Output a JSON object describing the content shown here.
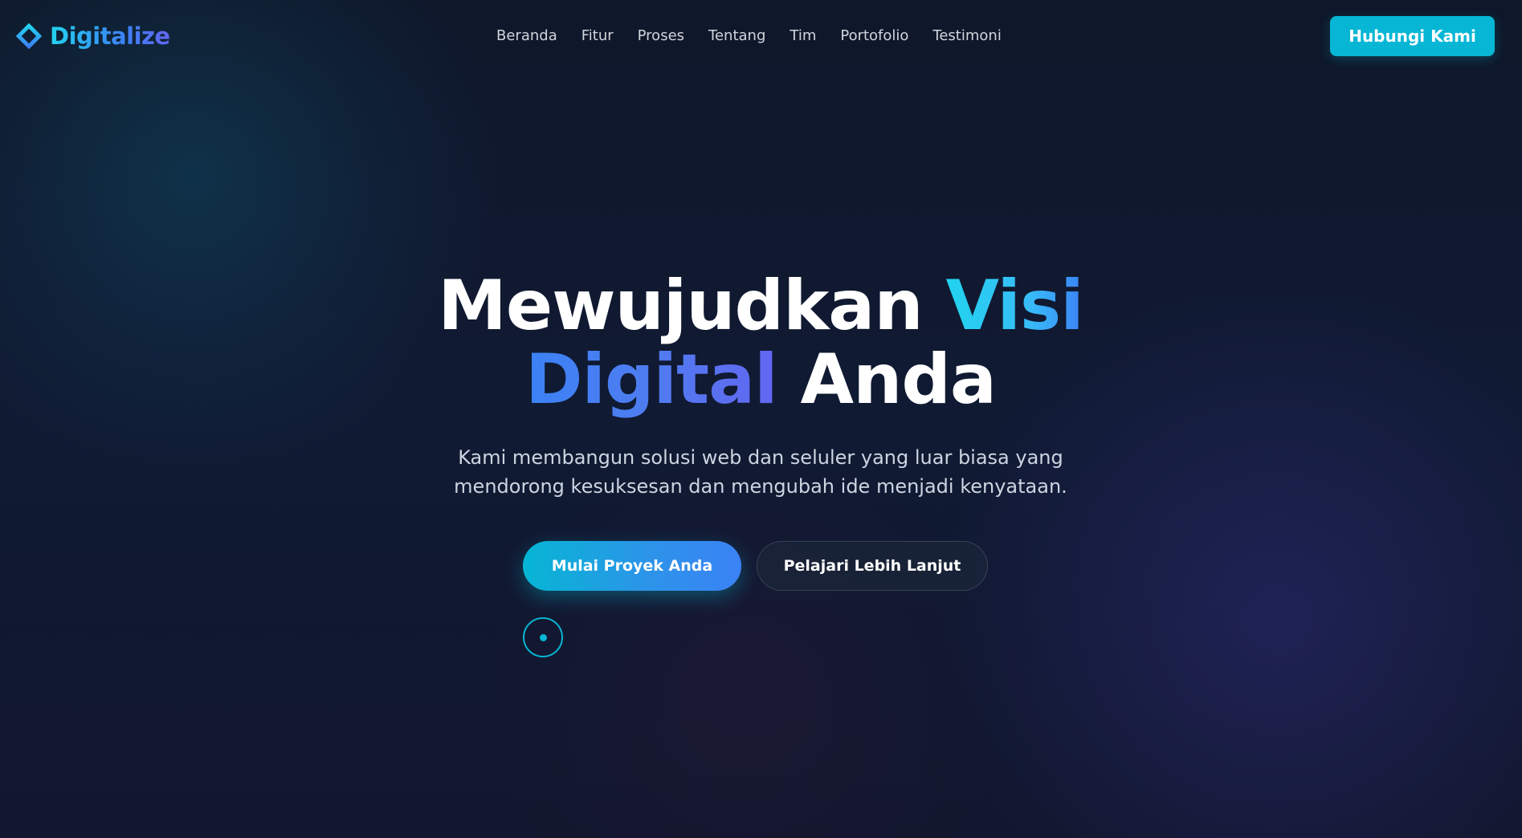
{
  "brand": {
    "name": "Digitalize",
    "icon": "diamond-outline-icon",
    "accent": "#06b6d4",
    "gradient": [
      "#22d3ee",
      "#3b82f6",
      "#6366f1"
    ]
  },
  "nav": {
    "links": [
      "Beranda",
      "Fitur",
      "Proses",
      "Tentang",
      "Tim",
      "Portofolio",
      "Testimoni"
    ],
    "cta_label": "Hubungi Kami"
  },
  "hero": {
    "headline": {
      "part1": "Mewujudkan",
      "highlight1": "Visi",
      "highlight2": "Digital",
      "part2": "Anda"
    },
    "subtitle_line1": "Kami membangun solusi web dan seluler yang luar biasa yang",
    "subtitle_line2": "mendorong kesuksesan dan mengubah ide menjadi kenyataan.",
    "primary_button_label": "Mulai Proyek Anda",
    "secondary_button_label": "Pelajari Lebih Lanjut",
    "scroll_indicator_icon": "scroll-mouse-icon"
  },
  "colors": {
    "background": "#0f172a",
    "text_primary": "#ffffff",
    "text_secondary": "#cbd5e1",
    "nav_text": "#d1d5db",
    "cta_background": "#06b6d4"
  }
}
